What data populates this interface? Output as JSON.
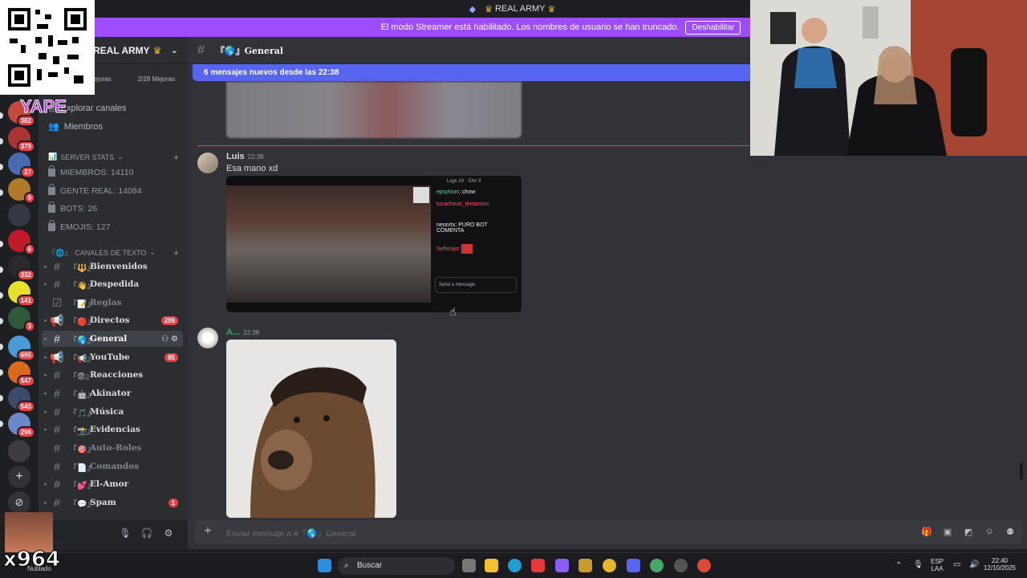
{
  "titlebar": {
    "title": "REAL ARMY"
  },
  "banner": {
    "text": "El modo Streamer está habilitado. Los nombres de usuario se han truncado.",
    "button": "Deshabilitar"
  },
  "server": {
    "name": "REAL ARMY",
    "boost_label": "Mejoras",
    "boost_count": "2/28 Mejoras",
    "explore": "Explorar canales",
    "members": "Miembros"
  },
  "stats": {
    "category": "SERVER STATS",
    "items": [
      "MIEMBROS: 14110",
      "GENTE REAL: 14084",
      "BOTS: 26",
      "EMOJIS: 127"
    ]
  },
  "channels": {
    "category": "CANALES DE TEXTO",
    "items": [
      {
        "name": "Bienvenidos",
        "emoji": "『🔱』"
      },
      {
        "name": "Despedida",
        "emoji": "『👋』"
      },
      {
        "name": "Reglas",
        "emoji": "『📝』"
      },
      {
        "name": "Directos",
        "emoji": "『🔴』",
        "count": "209"
      },
      {
        "name": "General",
        "emoji": "『🌎』"
      },
      {
        "name": "YouTube",
        "emoji": "『📢』",
        "count": "85"
      },
      {
        "name": "Reacciones",
        "emoji": "『😨』"
      },
      {
        "name": "Akinator",
        "emoji": "『🤖』"
      },
      {
        "name": "Música",
        "emoji": "『🎵』"
      },
      {
        "name": "Evidencias",
        "emoji": "『📸』"
      },
      {
        "name": "Auto-Roles",
        "emoji": "『🎯』"
      },
      {
        "name": "Comandos",
        "emoji": "『📄』"
      },
      {
        "name": "El-Amor",
        "emoji": "『💕』"
      },
      {
        "name": "Spam",
        "emoji": "『💬』",
        "count": "1"
      }
    ]
  },
  "server_badges": [
    "382",
    "379",
    "27",
    "9",
    "6",
    "332",
    "141",
    "3",
    "695",
    "547",
    "545",
    "296"
  ],
  "chat": {
    "channel": "『🌎』General",
    "new_messages": "6 mensajes nuevos desde las 22:38",
    "messages": [
      {
        "author": "Luis",
        "time": "22:38",
        "text": "Esa mano xd"
      },
      {
        "author": "A...",
        "time": "22:38",
        "text": ""
      }
    ],
    "embed_chat": {
      "header": "Lsgs 10 · Chri 3",
      "lines": [
        {
          "user": "epsyloon",
          "text": "chow",
          "color": "#56d3a8"
        },
        {
          "user": "tucachezo_tentacion",
          "text": "",
          "color": "#ff4f6b"
        },
        {
          "user": "neonrtx",
          "text": "PURO BOT COMENTA",
          "color": "#efeff1"
        },
        {
          "user": "Seftonijn",
          "text": "",
          "color": "#ff5050"
        }
      ],
      "placeholder": "Send a message"
    },
    "composer_placeholder": "Enviar mensaje a #『🌎』General"
  },
  "taskbar": {
    "search": "Buscar",
    "lang": "ESP",
    "lang_sub": "LAA",
    "time": "22:40",
    "date": "12/10/2025",
    "weather": "Nublado"
  },
  "overlays": {
    "yape": "YAPE",
    "tag": "x964"
  },
  "colors": {
    "accent": "#5865f2",
    "banner": "#9b4dff",
    "mention": "#f23f43"
  }
}
